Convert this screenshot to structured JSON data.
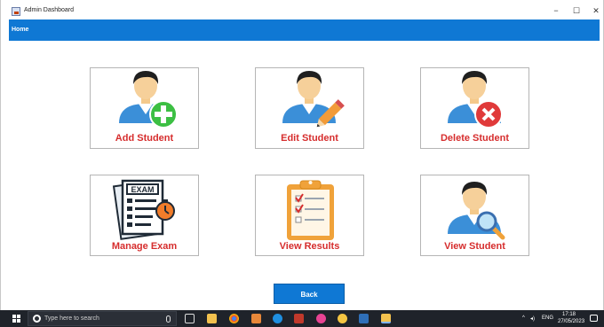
{
  "window": {
    "title": "Admin Dashboard",
    "minimize": "−",
    "maximize": "☐",
    "close": "✕"
  },
  "menubar": {
    "home": "Home"
  },
  "tiles": [
    {
      "label": "Add Student"
    },
    {
      "label": "Edit Student"
    },
    {
      "label": "Delete Student"
    },
    {
      "label": "Manage Exam"
    },
    {
      "label": "View Results"
    },
    {
      "label": "View Student"
    }
  ],
  "back_button": "Back",
  "taskbar": {
    "search_placeholder": "Type here to search",
    "language": "ENG",
    "time": "17:18",
    "date": "27/05/2023",
    "pinned_icons": [
      "task-view-icon",
      "file-explorer-icon",
      "chrome-icon",
      "files-icon",
      "edge-icon",
      "app-icon",
      "app-icon",
      "app-icon",
      "photos-icon",
      "netbeans-icon"
    ]
  },
  "colors": {
    "accent": "#0f78d4",
    "label_red": "#d62d2d"
  }
}
